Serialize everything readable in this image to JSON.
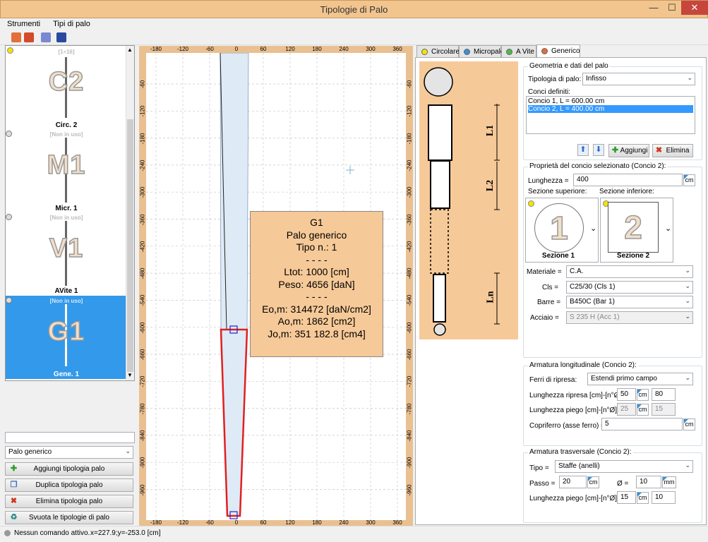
{
  "window": {
    "title": "Tipologie di Palo",
    "min": "—",
    "max": "☐",
    "close": "✕"
  },
  "menu": [
    "Strumenti",
    "Tipi di palo"
  ],
  "left_list": {
    "tiles": [
      {
        "big": "C2",
        "name": "Circ. 2",
        "status": "[1÷16]"
      },
      {
        "big": "M1",
        "name": "Micr. 1",
        "status": "[Non in uso]"
      },
      {
        "big": "V1",
        "name": "AVite 1",
        "status": "[Non in uso]"
      },
      {
        "big": "G1",
        "name": "Gene. 1",
        "status": "[Non in uso]"
      }
    ]
  },
  "left_panel": {
    "search_value": "",
    "type_select": "Palo generico",
    "buttons": [
      "Aggiungi tipologia palo",
      "Duplica tipologia palo",
      "Elimina tipologia palo",
      "Svuota le tipologie di palo"
    ]
  },
  "plot": {
    "x_ticks": [
      "-180",
      "-120",
      "-60",
      "0",
      "60",
      "120",
      "180",
      "240",
      "300",
      "360"
    ],
    "y_ticks": [
      "-60",
      "-120",
      "-180",
      "-240",
      "-300",
      "-360",
      "-420",
      "-480",
      "-540",
      "-600",
      "-660",
      "-720",
      "-780",
      "-840",
      "-900",
      "-960"
    ],
    "info": [
      "G1",
      "Palo generico",
      "Tipo n.: 1",
      "- - - -",
      "Ltot: 1000 [cm]",
      "Peso: 4656 [daN]",
      "- - - -",
      "Eo,m: 314472 [daN/cm2]",
      "Ao,m: 1862 [cm2]",
      "Jo,m: 351 182.8 [cm4]"
    ]
  },
  "tabs": [
    "Circolare",
    "Micropalo",
    "A Vite",
    "Generico"
  ],
  "tab_colors": [
    "#f5e400",
    "#3a8fd8",
    "#4cbb4c",
    "#e86a3a"
  ],
  "schema_labels": {
    "l1": "L1",
    "l2": "L2",
    "ln": "Ln"
  },
  "geometria": {
    "legend": "Geometria e dati del palo",
    "tipologia_label": "Tipologia di palo:",
    "tipologia_value": "Infisso",
    "conci_label": "Conci definiti:",
    "conci": [
      "Concio 1, L = 600.00 cm",
      "Concio 2, L = 400.00 cm"
    ],
    "aggiungi": "Aggiungi",
    "elimina": "Elimina"
  },
  "proprieta": {
    "legend": "Proprietà del concio selezionato (Concio 2):",
    "lunghezza_label": "Lunghezza =",
    "lunghezza_value": "400",
    "unit_cm": "cm",
    "sez_sup_label": "Sezione superiore:",
    "sez_inf_label": "Sezione inferiore:",
    "sez1_num": "1",
    "sez1_name": "Sezione 1",
    "sez2_num": "2",
    "sez2_name": "Sezione 2",
    "materiale_label": "Materiale =",
    "materiale_value": "C.A.",
    "cls_label": "Cls =",
    "cls_value": "C25/30 (Cls 1)",
    "barre_label": "Barre =",
    "barre_value": "B450C (Bar 1)",
    "acciaio_label": "Acciaio =",
    "acciaio_value": "S 235 H (Acc 1)"
  },
  "arm_long": {
    "legend": "Armatura longitudinale (Concio 2):",
    "ferri_label": "Ferri di ripresa:",
    "ferri_value": "Estendi primo campo",
    "lr_label": "Lunghezza ripresa [cm]-[n°Ø]=",
    "lr_cm": "50",
    "lr_n": "80",
    "lp_label": "Lunghezza piego [cm]-[n°Ø]=",
    "lp_cm": "25",
    "lp_n": "15",
    "copri_label": "Copriferro (asse ferro) =",
    "copri_value": "5"
  },
  "arm_trasv": {
    "legend": "Armatura trasversale (Concio 2):",
    "tipo_label": "Tipo =",
    "tipo_value": "Staffe (anelli)",
    "passo_label": "Passo =",
    "passo_value": "20",
    "diam_label": "Ø =",
    "diam_value": "10",
    "unit_mm": "mm",
    "lp_label": "Lunghezza piego [cm]-[n°Ø]=",
    "lp_cm": "15",
    "lp_n": "10"
  },
  "status": {
    "text": "Nessun comando attivo.",
    "coords": "x=227.9;y=-253.0 [cm]"
  }
}
